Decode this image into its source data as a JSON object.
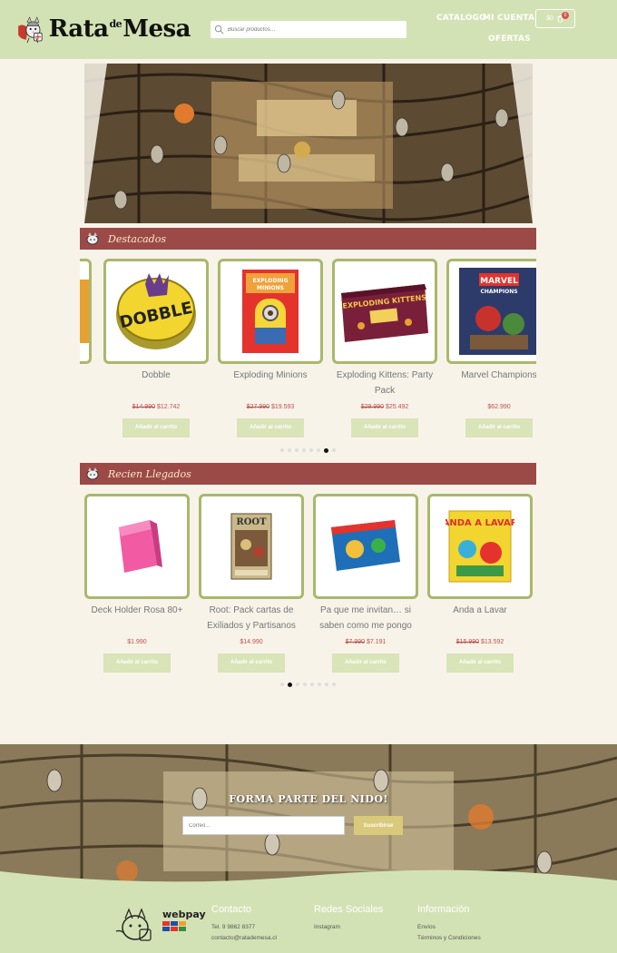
{
  "header": {
    "logo": {
      "word1": "Rata",
      "word_small": "de",
      "word2": "Mesa"
    },
    "search": {
      "placeholder": "Buscar productos…"
    },
    "nav": {
      "catalogo": "CATALOGO",
      "mi_cuenta": "MI CUENTA",
      "ofertas": "OFERTAS"
    },
    "cart": {
      "total": "$0",
      "count": "0"
    }
  },
  "destacados": {
    "title": "Destacados",
    "products": [
      {
        "name": "Dobble",
        "old_price": "$14.990",
        "price": "$12.742",
        "button": "Añadir al carrito"
      },
      {
        "name": "Exploding Minions",
        "old_price": "$27.990",
        "price": "$19.593",
        "button": "Añadir al carrito"
      },
      {
        "name": "Exploding Kittens: Party Pack",
        "old_price": "$29.990",
        "price": "$25.492",
        "button": "Añadir al carrito"
      },
      {
        "name": "Marvel Champions",
        "old_price": "",
        "price": "$62.990",
        "button": "Añadir al carrito"
      }
    ],
    "dots": {
      "count": 8,
      "active": 6
    }
  },
  "recien": {
    "title": "Recien Llegados",
    "products": [
      {
        "name": "Deck Holder Rosa 80+",
        "old_price": "",
        "price": "$1.990",
        "button": "Añadir al carrito"
      },
      {
        "name": "Root: Pack cartas de Exiliados y Partisanos",
        "old_price": "",
        "price": "$14.990",
        "button": "Añadir al carrito"
      },
      {
        "name": "Pa que me invitan… si saben como me pongo",
        "old_price": "$7.990",
        "price": "$7.191",
        "button": "Añadir al carrito"
      },
      {
        "name": "Anda a Lavar",
        "old_price": "$15.990",
        "price": "$13.592",
        "button": "Añadir al carrito"
      }
    ],
    "dots": {
      "count": 8,
      "active": 1
    }
  },
  "newsletter": {
    "title": "FORMA PARTE DEL NIDO!",
    "input_placeholder": "Correo...",
    "button": "Suscribirse"
  },
  "footer": {
    "payment_logo": "webpay",
    "contacto": {
      "title": "Contacto",
      "phone": "Tel. 9 9862 8377",
      "email": "contacto@ratademesa.cl"
    },
    "redes": {
      "title": "Redes Sociales",
      "instagram": "Instagram"
    },
    "info": {
      "title": "Información",
      "envios": "Envíos",
      "terminos": "Términos y Condiciones"
    }
  },
  "colors": {
    "header_bg": "#d3e2b4",
    "section_bar": "#9b4a48",
    "card_border": "#a9b86c",
    "button_bg": "#d9e4b8",
    "sale_price": "#c0504d",
    "subscribe_button": "#d9c97a"
  },
  "icons": [
    "search-icon",
    "cart-icon",
    "rat-mascot-icon"
  ]
}
